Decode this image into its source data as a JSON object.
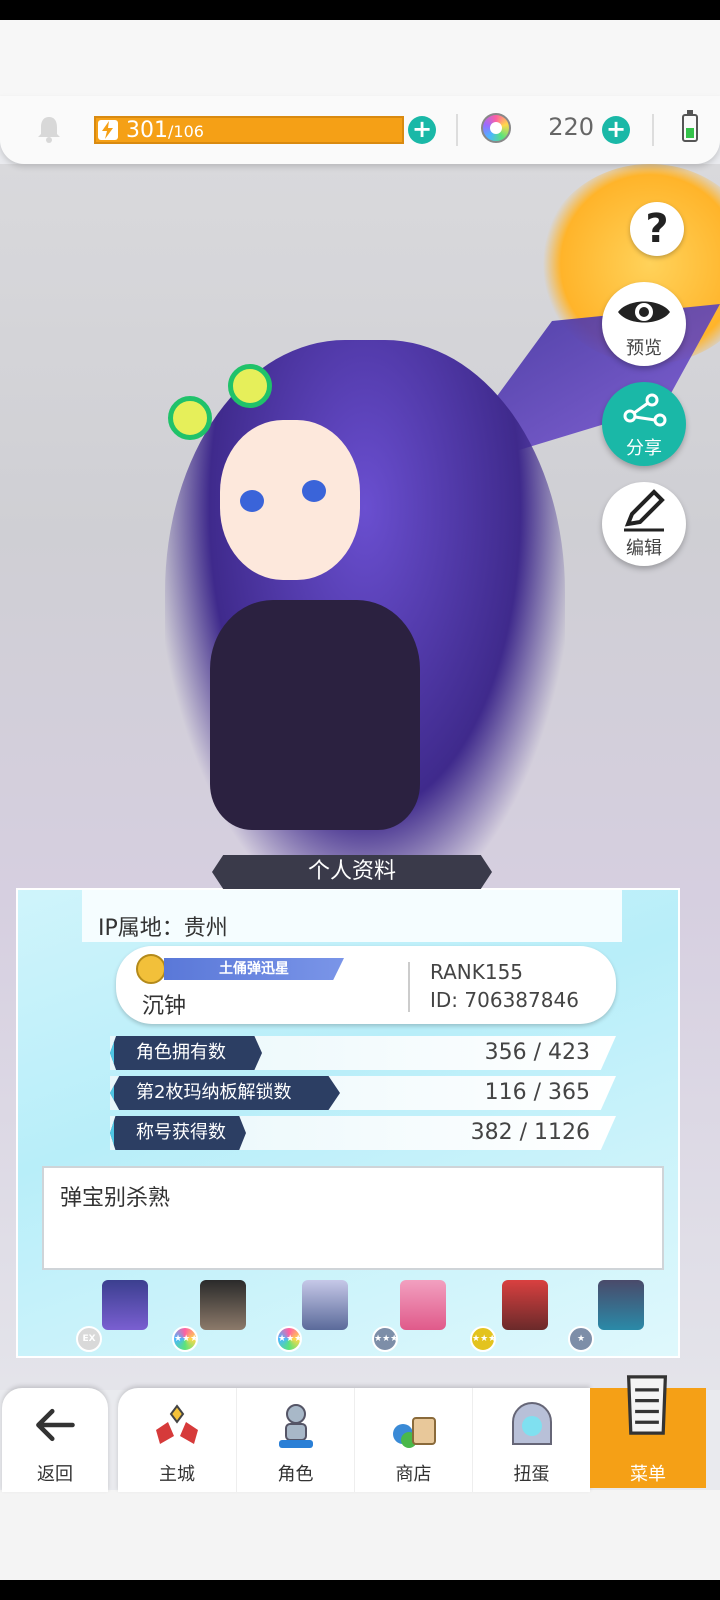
{
  "topbar": {
    "stamina_current": "301",
    "stamina_max": "/106",
    "gem_count": "220",
    "icons": [
      "bell-icon",
      "bolt-icon",
      "plus-icon",
      "gem-icon",
      "battery-icon"
    ]
  },
  "side_buttons": {
    "help": "?",
    "preview": "预览",
    "share": "分享",
    "edit": "编辑"
  },
  "profile": {
    "header": "个人资料",
    "ip_location": "IP属地：贵州",
    "title_badge": "土俑弹迅星",
    "player_name": "沉钟",
    "rank": "RANK155",
    "player_id": "ID: 706387846",
    "stats": [
      {
        "label": "角色拥有数",
        "value": "356 / 423"
      },
      {
        "label": "第2枚玛纳板解锁数",
        "value": "116 / 365"
      },
      {
        "label": "称号获得数",
        "value": "382 / 1126"
      }
    ],
    "signature": "弹宝别杀熟",
    "team_rarities": [
      "EX",
      "★★★",
      "★★★",
      "★★★",
      "★★★",
      "★"
    ]
  },
  "nav": {
    "back": "返回",
    "items": [
      "主城",
      "角色",
      "商店",
      "扭蛋"
    ],
    "menu": "菜单"
  },
  "colors": {
    "accent_orange": "#f5a016",
    "accent_teal": "#1ab8a7",
    "stat_label_bg": "#2c3e63"
  }
}
